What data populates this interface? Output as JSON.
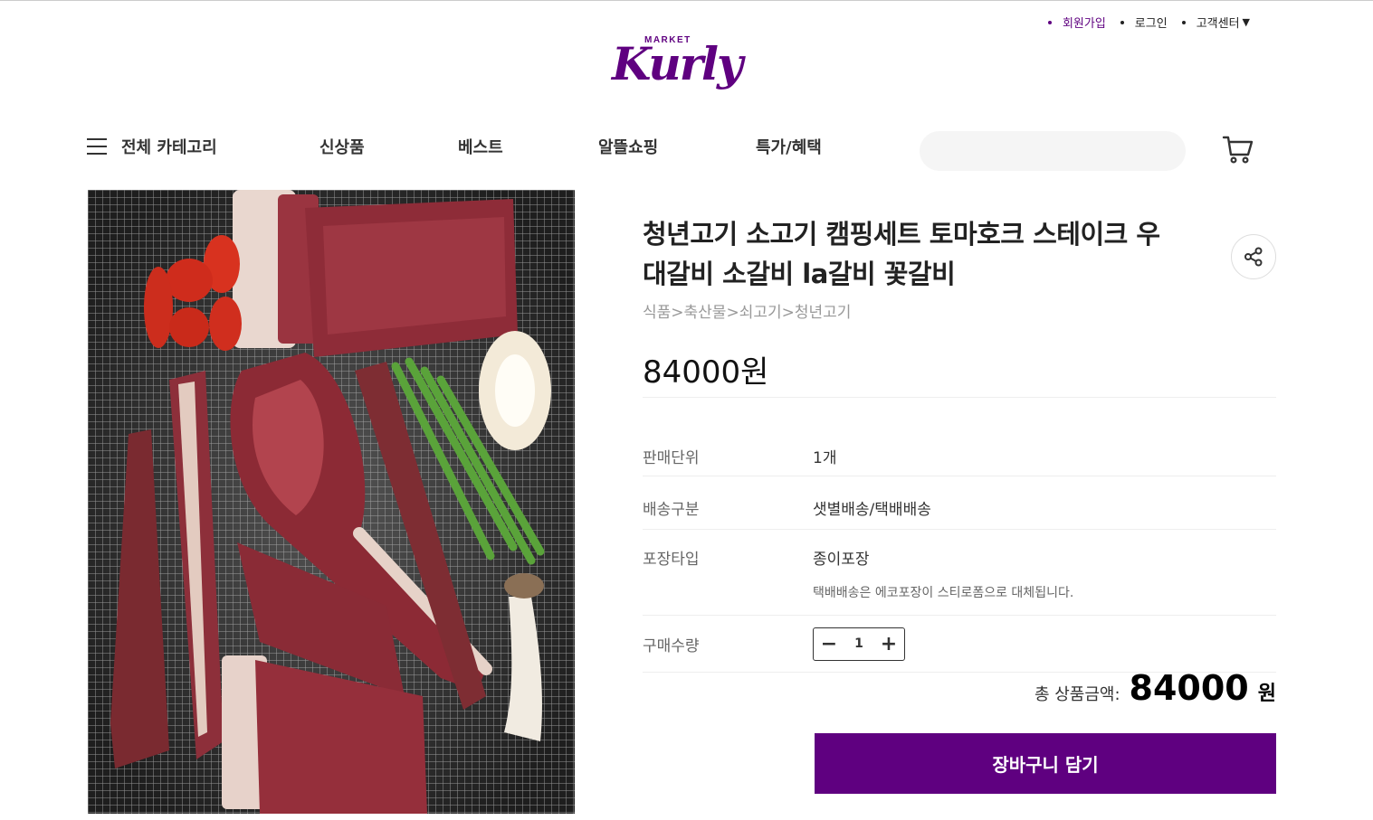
{
  "header": {
    "top_links": [
      {
        "label": "회원가입"
      },
      {
        "label": "로그인"
      },
      {
        "label": "고객센터"
      }
    ],
    "customer_center_arrow": "▼",
    "logo": {
      "market": "MARKET",
      "brand": "Kurly"
    }
  },
  "gnb": {
    "all_category": "전체 카테고리",
    "items": [
      "신상품",
      "베스트",
      "알뜰쇼핑",
      "특가/혜택"
    ],
    "search_placeholder": ""
  },
  "product": {
    "title": "청년고기 소고기 캠핑세트 토마호크 스테이크 우대갈비 소갈비 la갈비 꽃갈비",
    "breadcrumb": "식품>축산물>쇠고기>청년고기",
    "price": "84000원",
    "specs": [
      {
        "label": "판매단위",
        "value": "1개"
      },
      {
        "label": "배송구분",
        "value": "샛별배송/택배배송"
      },
      {
        "label": "포장타입",
        "value": "종이포장",
        "note": "택배배송은 에코포장이 스티로폼으로 대체됩니다."
      }
    ],
    "quantity": {
      "label": "구매수량",
      "value": "1",
      "minus": "−",
      "plus": "+"
    },
    "total": {
      "label": "총 상품금액:",
      "value": "84000",
      "unit": "원"
    },
    "add_to_cart": "장바구니 담기"
  },
  "colors": {
    "brand": "#5f0080",
    "search_bg": "#f5f5f5"
  }
}
